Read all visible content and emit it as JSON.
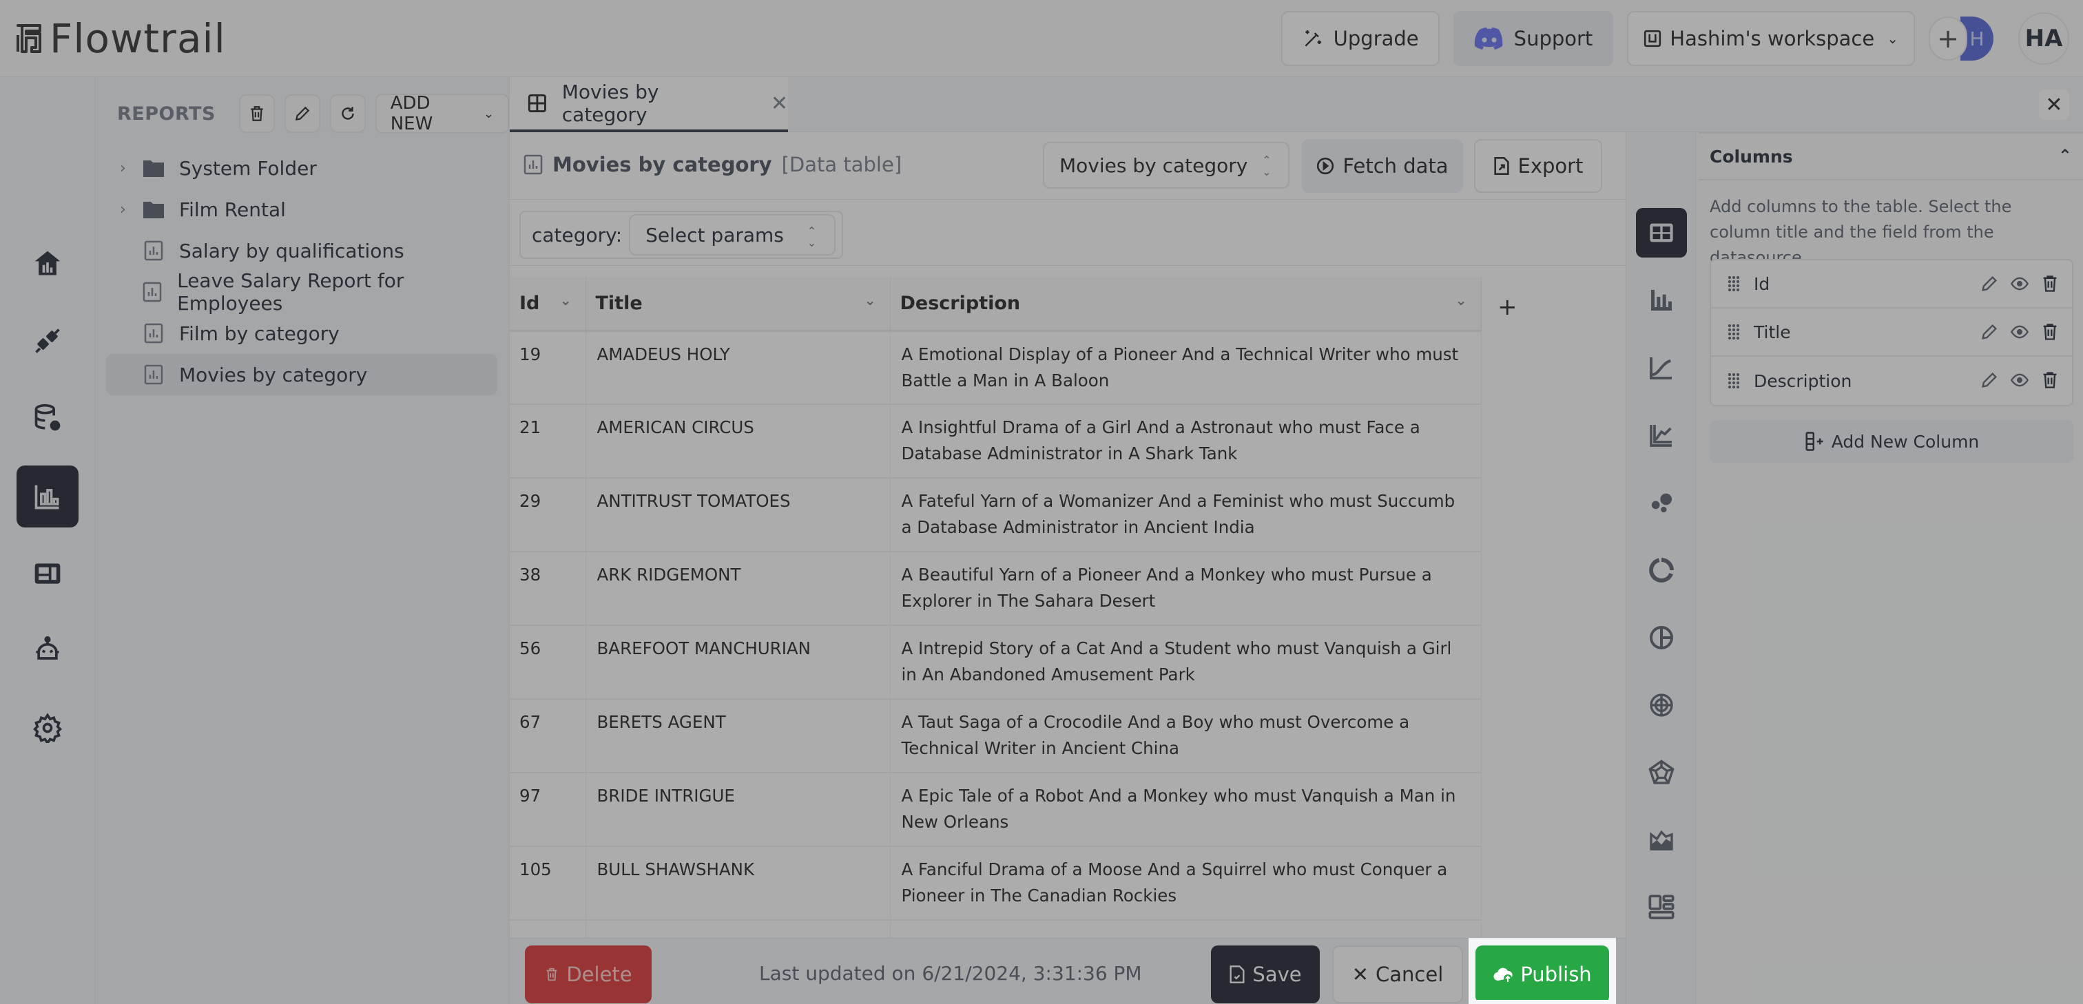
{
  "app": {
    "name": "Flowtrail"
  },
  "header": {
    "upgrade_label": "Upgrade",
    "support_label": "Support",
    "workspace_label": "Hashim's workspace",
    "avatar_initial": "H",
    "user_initials": "HA",
    "add_member_label": "+",
    "support_icon_color": "#5865F2"
  },
  "rail": {
    "items": [
      {
        "name": "home",
        "icon": "home-chart-icon",
        "active": false
      },
      {
        "name": "connections",
        "icon": "plug-icon",
        "active": false
      },
      {
        "name": "datasources",
        "icon": "database-gear-icon",
        "active": false
      },
      {
        "name": "reports",
        "icon": "bar-chart-icon",
        "active": true
      },
      {
        "name": "dashboards",
        "icon": "dashboard-icon",
        "active": false
      },
      {
        "name": "ai-assistant",
        "icon": "robot-icon",
        "active": false
      },
      {
        "name": "settings",
        "icon": "gear-icon",
        "active": false
      }
    ]
  },
  "reports": {
    "title": "REPORTS",
    "add_new_label": "ADD NEW",
    "tree": [
      {
        "label": "System Folder",
        "type": "folder",
        "expandable": true,
        "active": false
      },
      {
        "label": "Film Rental",
        "type": "folder",
        "expandable": true,
        "active": false
      },
      {
        "label": "Salary by qualifications",
        "type": "report",
        "expandable": false,
        "active": false
      },
      {
        "label": "Leave Salary Report for Employees",
        "type": "report",
        "expandable": false,
        "active": false
      },
      {
        "label": "Film by category",
        "type": "report",
        "expandable": false,
        "active": false
      },
      {
        "label": "Movies by category",
        "type": "report",
        "expandable": false,
        "active": true
      }
    ]
  },
  "tabs": [
    {
      "label": "Movies by category",
      "active": true
    }
  ],
  "report": {
    "name": "Movies by category",
    "type_label": "[Data table]",
    "datasource_value": "Movies by category",
    "fetch_label": "Fetch data",
    "export_label": "Export",
    "param_label": "category:",
    "param_placeholder": "Select params"
  },
  "table": {
    "columns": [
      "Id",
      "Title",
      "Description"
    ],
    "add_column_label": "+",
    "rows": [
      {
        "id": "19",
        "title": "AMADEUS HOLY",
        "description": "A Emotional Display of a Pioneer And a Technical Writer who must Battle a Man in A Baloon"
      },
      {
        "id": "21",
        "title": "AMERICAN CIRCUS",
        "description": "A Insightful Drama of a Girl And a Astronaut who must Face a Database Administrator in A Shark Tank"
      },
      {
        "id": "29",
        "title": "ANTITRUST TOMATOES",
        "description": "A Fateful Yarn of a Womanizer And a Feminist who must Succumb a Database Administrator in Ancient India"
      },
      {
        "id": "38",
        "title": "ARK RIDGEMONT",
        "description": "A Beautiful Yarn of a Pioneer And a Monkey who must Pursue a Explorer in The Sahara Desert"
      },
      {
        "id": "56",
        "title": "BAREFOOT MANCHURIAN",
        "description": "A Intrepid Story of a Cat And a Student who must Vanquish a Girl in An Abandoned Amusement Park"
      },
      {
        "id": "67",
        "title": "BERETS AGENT",
        "description": "A Taut Saga of a Crocodile And a Boy who must Overcome a Technical Writer in Ancient China"
      },
      {
        "id": "97",
        "title": "BRIDE INTRIGUE",
        "description": "A Epic Tale of a Robot And a Monkey who must Vanquish a Man in New Orleans"
      },
      {
        "id": "105",
        "title": "BULL SHAWSHANK",
        "description": "A Fanciful Drama of a Moose And a Squirrel who must Conquer a Pioneer in The Canadian Rockies"
      }
    ]
  },
  "actions": {
    "delete_label": "Delete",
    "last_updated": "Last updated on 6/21/2024, 3:31:36 PM",
    "save_label": "Save",
    "cancel_label": "Cancel",
    "publish_label": "Publish"
  },
  "chart_types": [
    {
      "name": "table",
      "active": true
    },
    {
      "name": "bar",
      "active": false
    },
    {
      "name": "line",
      "active": false
    },
    {
      "name": "multi-line",
      "active": false
    },
    {
      "name": "scatter",
      "active": false
    },
    {
      "name": "doughnut",
      "active": false
    },
    {
      "name": "pie",
      "active": false
    },
    {
      "name": "polar",
      "active": false
    },
    {
      "name": "radar",
      "active": false
    },
    {
      "name": "area",
      "active": false
    },
    {
      "name": "layout",
      "active": false
    }
  ],
  "columns_panel": {
    "title": "Columns",
    "help": "Add columns to the table. Select the column title and the field from the datasource.",
    "items": [
      "Id",
      "Title",
      "Description"
    ],
    "add_label": "Add New Column"
  },
  "colors": {
    "primary_dark": "#0b1120",
    "delete": "#dc2626",
    "publish": "#28a745",
    "avatar": "#4658d6",
    "overlay": "rgba(70,70,70,0.45)"
  },
  "spotlight": {
    "target": "publish-button"
  }
}
